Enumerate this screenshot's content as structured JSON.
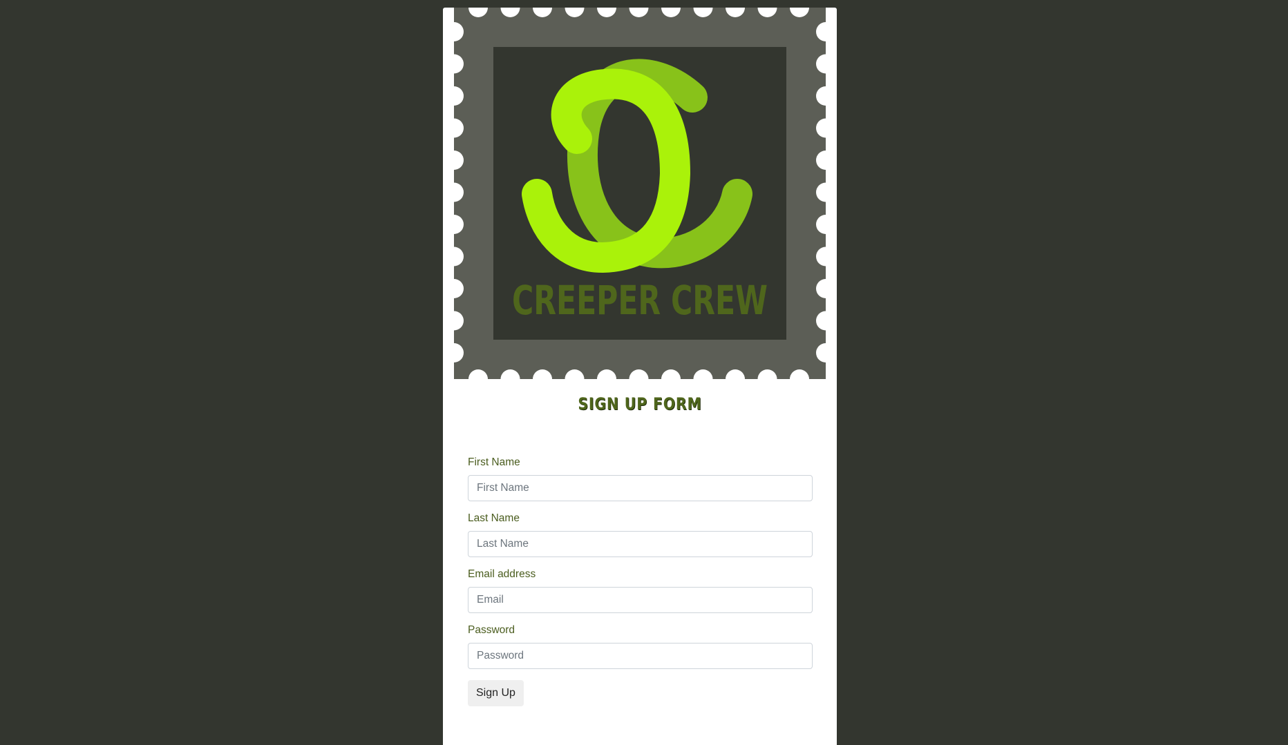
{
  "logo": {
    "brand_text": "CREEPER CREW",
    "colors": {
      "stamp_border": "#5c5e56",
      "stamp_inner": "#33362f",
      "c_bright": "#aaf20a",
      "c_dark": "#88c21a",
      "brand_text": "#4f661c"
    }
  },
  "form": {
    "title": "SIGN UP FORM",
    "fields": [
      {
        "label": "First Name",
        "placeholder": "First Name"
      },
      {
        "label": "Last Name",
        "placeholder": "Last Name"
      },
      {
        "label": "Email address",
        "placeholder": "Email"
      },
      {
        "label": "Password",
        "placeholder": "Password"
      }
    ],
    "submit_label": "Sign Up"
  }
}
